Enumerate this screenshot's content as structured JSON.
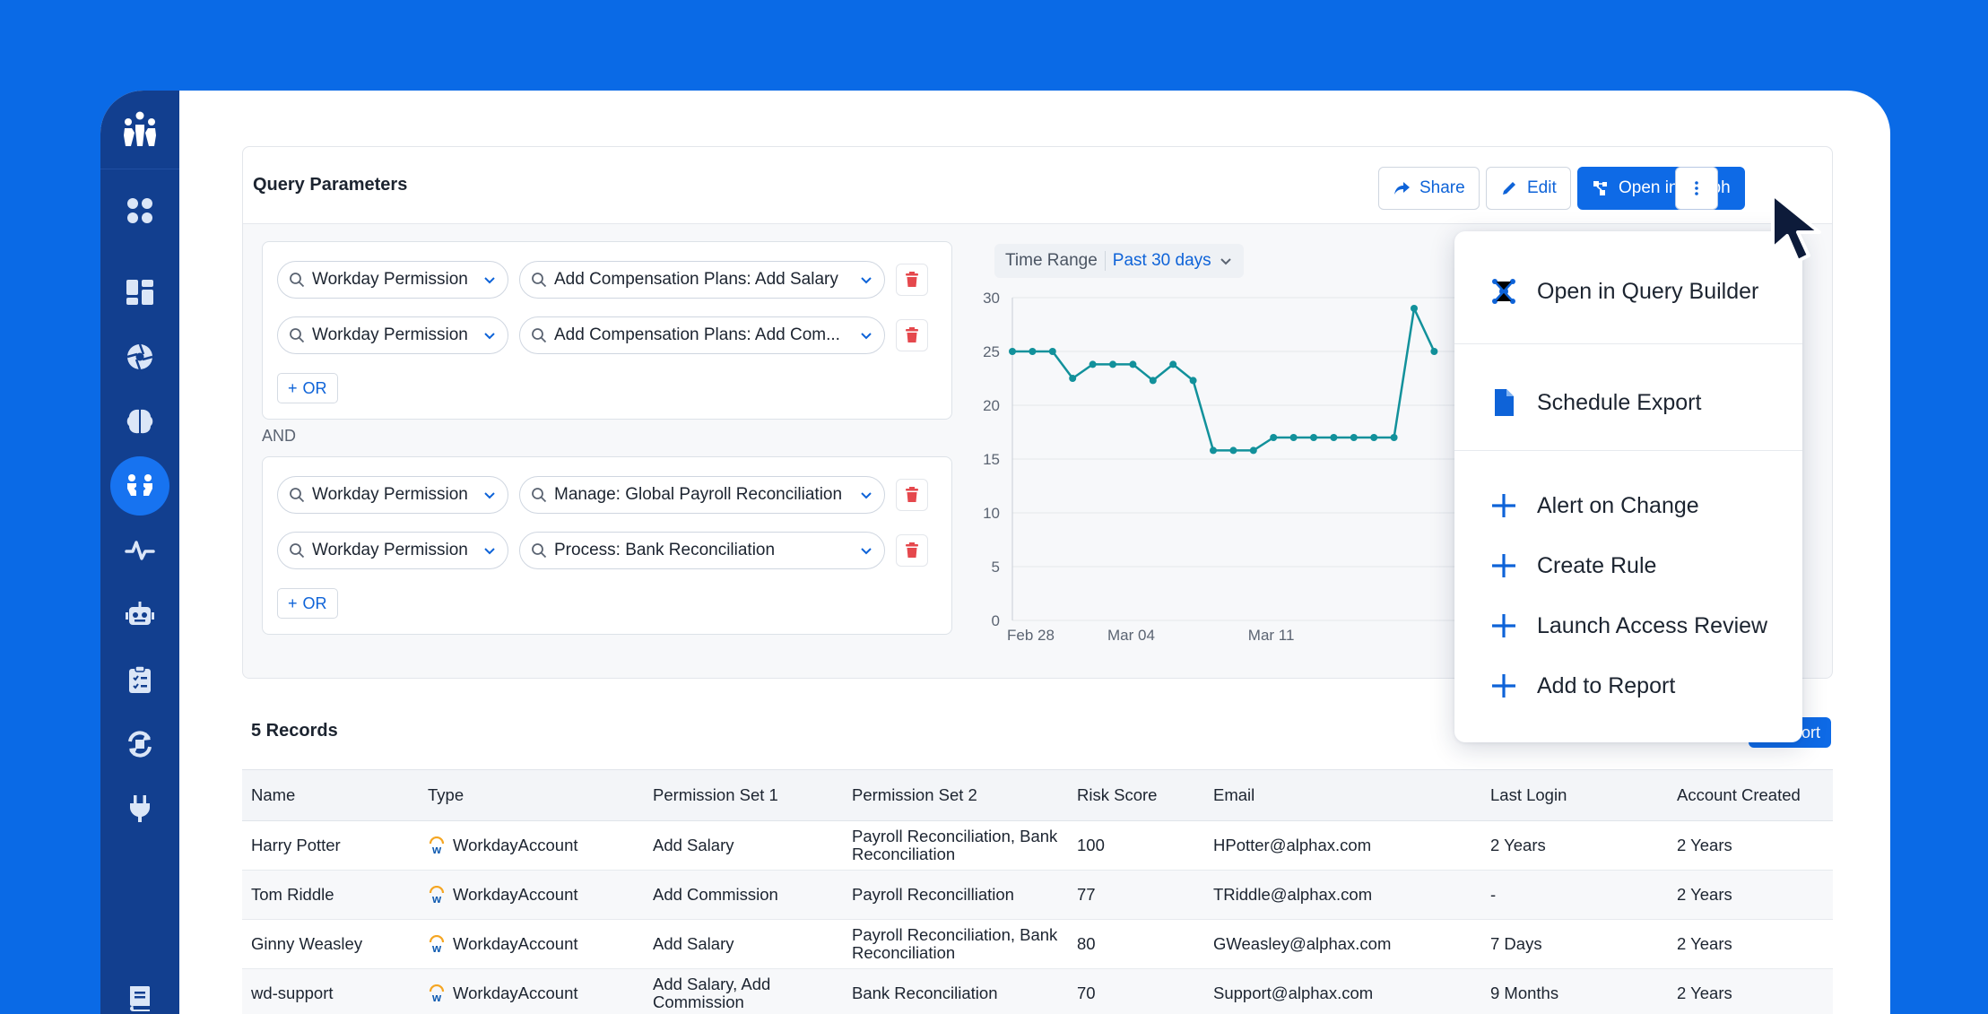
{
  "query_card": {
    "title": "Query Parameters",
    "share_label": "Share",
    "edit_label": "Edit",
    "open_graph_label": "Open in Graph"
  },
  "groups": [
    {
      "rows": [
        {
          "field": "Workday Permission",
          "value": "Add Compensation Plans: Add Salary"
        },
        {
          "field": "Workday Permission",
          "value": "Add Compensation Plans: Add Com..."
        }
      ],
      "or_label": "OR"
    },
    {
      "rows": [
        {
          "field": "Workday Permission",
          "value": "Manage: Global Payroll Reconciliation"
        },
        {
          "field": "Workday Permission",
          "value": "Process: Bank Reconciliation"
        }
      ],
      "or_label": "OR"
    }
  ],
  "and_label": "AND",
  "time_range": {
    "label": "Time Range",
    "value": "Past 30 days"
  },
  "chart_data": {
    "type": "line",
    "x": [
      "Feb 28",
      "Feb 29",
      "Mar 01",
      "Mar 02",
      "Mar 03",
      "Mar 04",
      "Mar 05",
      "Mar 06",
      "Mar 07",
      "Mar 08",
      "Mar 09",
      "Mar 10",
      "Mar 11",
      "Mar 12",
      "Mar 13",
      "Mar 14",
      "Mar 15",
      "Mar 16",
      "Mar 17",
      "Mar 18",
      "Mar 19",
      "Mar 20"
    ],
    "series": [
      {
        "values": [
          25,
          25,
          25,
          22.5,
          23.8,
          23.8,
          23.8,
          22.3,
          23.8,
          22.3,
          15.8,
          15.8,
          15.8,
          17,
          17,
          17,
          17,
          17,
          17,
          17,
          29,
          25
        ]
      }
    ],
    "xticks": [
      "Feb 28",
      "Mar 04",
      "Mar 11"
    ],
    "yticks": [
      0,
      5,
      10,
      15,
      20,
      25,
      30
    ],
    "ylim": [
      0,
      30
    ],
    "color": "#12919b",
    "grid": true
  },
  "records": {
    "title": "5 Records",
    "export_label": "Export",
    "columns": [
      "Name",
      "Type",
      "Permission Set 1",
      "Permission Set 2",
      "Risk Score",
      "Email",
      "Last Login",
      "Account Created"
    ],
    "rows": [
      {
        "name": "Harry Potter",
        "type": "WorkdayAccount",
        "ps1": "Add Salary",
        "ps2": "Payroll Reconciliation, Bank Reconciliation",
        "risk": "100",
        "email": "HPotter@alphax.com",
        "last_login": "2 Years",
        "created": "2 Years"
      },
      {
        "name": "Tom Riddle",
        "type": "WorkdayAccount",
        "ps1": "Add Commission",
        "ps2": "Payroll Reconcilliation",
        "risk": "77",
        "email": "TRiddle@alphax.com",
        "last_login": "-",
        "created": "2 Years"
      },
      {
        "name": "Ginny Weasley",
        "type": "WorkdayAccount",
        "ps1": "Add Salary",
        "ps2": "Payroll Reconciliation, Bank Reconciliation",
        "risk": "80",
        "email": "GWeasley@alphax.com",
        "last_login": "7 Days",
        "created": "2 Years"
      },
      {
        "name": "wd-support",
        "type": "WorkdayAccount",
        "ps1": "Add Salary, Add Commission",
        "ps2": "Bank Reconciliation",
        "risk": "70",
        "email": "Support@alphax.com",
        "last_login": "9 Months",
        "created": "2 Years"
      }
    ]
  },
  "menu": {
    "open_query_builder": "Open in Query Builder",
    "schedule_export": "Schedule Export",
    "alert_on_change": "Alert on Change",
    "create_rule": "Create Rule",
    "launch_access_review": "Launch Access Review",
    "add_to_report": "Add to Report"
  },
  "colors": {
    "brand": "#0a6ae6",
    "sidebar": "#123f8f",
    "line": "#12919b",
    "danger": "#e5484d"
  }
}
